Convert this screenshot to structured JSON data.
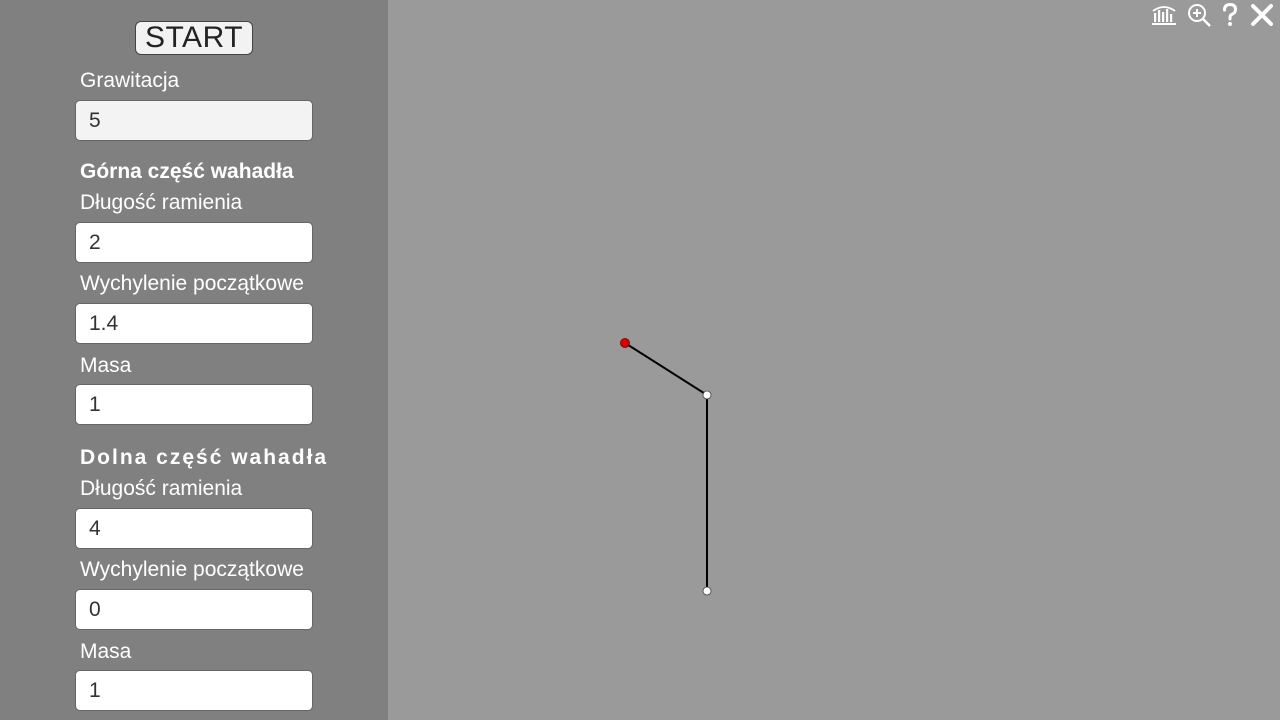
{
  "controls": {
    "start_label": "START",
    "gravity": {
      "label": "Grawitacja",
      "value": "5"
    },
    "upper": {
      "heading": "Górna część wahadła",
      "length": {
        "label": "Długość ramienia",
        "value": "2"
      },
      "angle": {
        "label": "Wychylenie początkowe",
        "value": "1.4"
      },
      "mass": {
        "label": "Masa",
        "value": "1"
      }
    },
    "lower": {
      "heading": "Dolna część wahadła",
      "length": {
        "label": "Długość ramienia",
        "value": "4"
      },
      "angle": {
        "label": "Wychylenie początkowe",
        "value": "0"
      },
      "mass": {
        "label": "Masa",
        "value": "1"
      }
    }
  },
  "toolbar": {
    "icons": [
      "chart-icon",
      "zoom-in-icon",
      "help-icon",
      "close-icon"
    ]
  },
  "colors": {
    "sidebar": "#808080",
    "canvas": "#9a9a9a",
    "pivot": "#dd0000",
    "bob": "#ffffff"
  }
}
